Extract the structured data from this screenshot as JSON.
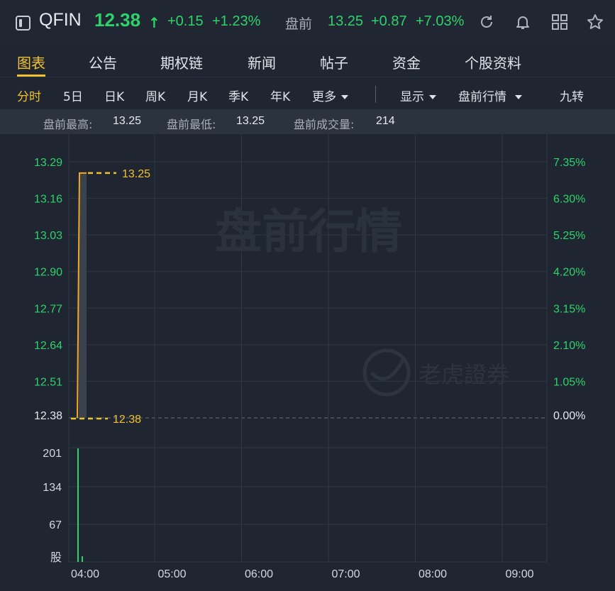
{
  "header": {
    "ticker": "QFIN",
    "price": "12.38",
    "price_arrow": "↑",
    "change": "+0.15",
    "change_pct": "+1.23%",
    "premarket_label": "盘前",
    "premarket_price": "13.25",
    "premarket_change": "+0.87",
    "premarket_change_pct": "+7.03%",
    "icons": [
      "sidebar-toggle-icon",
      "refresh-icon",
      "bell-icon",
      "grid-icon",
      "star-icon"
    ]
  },
  "tabs": [
    "图表",
    "公告",
    "期权链",
    "新闻",
    "帖子",
    "资金",
    "个股资料"
  ],
  "active_tab": "图表",
  "periods": {
    "items": [
      "分时",
      "5日",
      "日K",
      "周K",
      "月K",
      "季K",
      "年K"
    ],
    "more": "更多",
    "display": "显示",
    "premarket_quote": "盘前行情",
    "nine_turn": "九转",
    "active": "分时"
  },
  "stats": {
    "high_label": "盘前最高:",
    "high_value": "13.25",
    "low_label": "盘前最低:",
    "low_value": "13.25",
    "volume_label": "盘前成交量:",
    "volume_value": "214"
  },
  "watermark": {
    "title": "盘前行情",
    "brand": "老虎證券"
  },
  "colors": {
    "up": "#2fd26a",
    "accent": "#f2c12e",
    "price_line": "#f5a623",
    "grid": "#2f3844"
  },
  "chart_data": {
    "type": "line",
    "x_ticks": [
      "04:00",
      "05:00",
      "06:00",
      "07:00",
      "08:00",
      "09:00"
    ],
    "price_ticks_left": [
      "13.29",
      "13.16",
      "13.03",
      "12.90",
      "12.77",
      "12.64",
      "12.51",
      "12.38"
    ],
    "pct_ticks_right": [
      "7.35%",
      "6.30%",
      "5.25%",
      "4.20%",
      "3.15%",
      "2.10%",
      "1.05%",
      "0.00%"
    ],
    "ylim": [
      12.38,
      13.29
    ],
    "reference_price": 12.38,
    "price_series": [
      {
        "t": "04:00",
        "price": 12.38
      },
      {
        "t": "04:00",
        "price": 13.25
      }
    ],
    "marks": {
      "high_label": "13.25",
      "base_label": "12.38"
    },
    "volume": {
      "ticks": [
        "201",
        "134",
        "67"
      ],
      "unit": "股",
      "ylim": [
        0,
        201
      ],
      "bars": [
        {
          "t": "04:00",
          "value": 214
        },
        {
          "t": "04:00",
          "value": 12
        }
      ]
    }
  }
}
